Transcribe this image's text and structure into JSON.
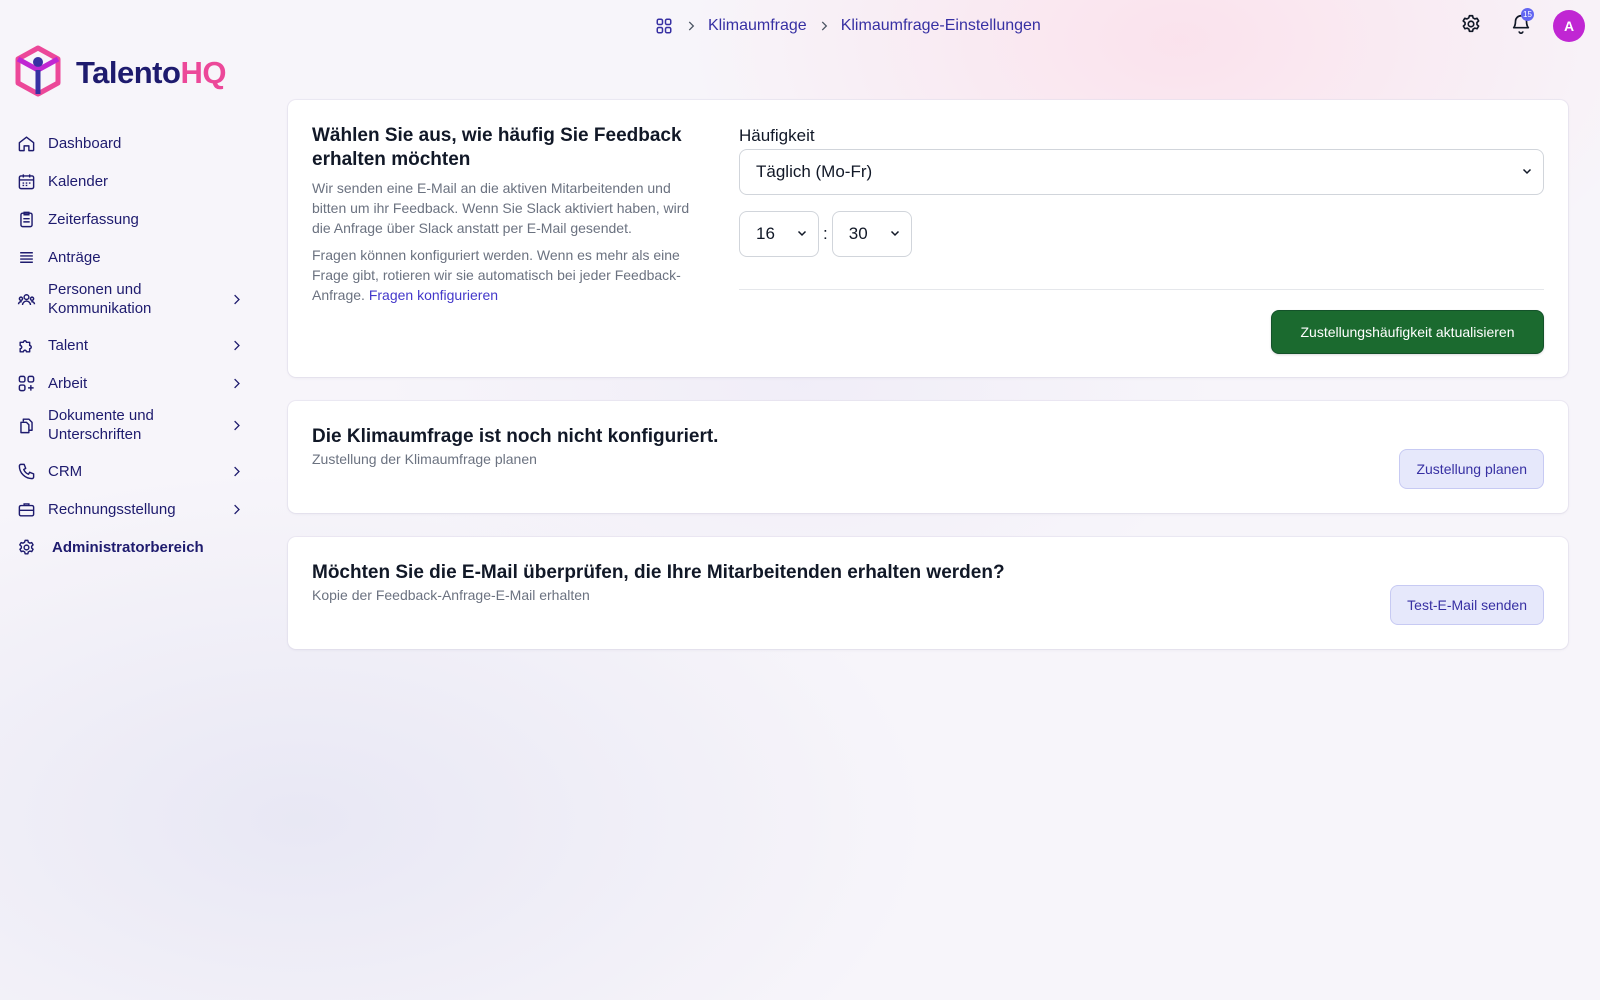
{
  "breadcrumb": {
    "items": [
      "Klimaumfrage",
      "Klimaumfrage-Einstellungen"
    ]
  },
  "topbar": {
    "notification_count": "15",
    "avatar_initial": "A"
  },
  "brand": {
    "name_part1": "Talento",
    "name_part2": "HQ",
    "colors": {
      "primary": "#1e1b6e",
      "accent": "#ec4899"
    }
  },
  "sidebar": {
    "items": [
      {
        "label": "Dashboard",
        "icon": "home-icon",
        "expandable": false
      },
      {
        "label": "Kalender",
        "icon": "calendar-icon",
        "expandable": false
      },
      {
        "label": "Zeiterfassung",
        "icon": "clipboard-icon",
        "expandable": false
      },
      {
        "label": "Anträge",
        "icon": "list-icon",
        "expandable": false
      },
      {
        "label": "Personen und Kommunikation",
        "icon": "users-icon",
        "expandable": true
      },
      {
        "label": "Talent",
        "icon": "puzzle-icon",
        "expandable": true
      },
      {
        "label": "Arbeit",
        "icon": "apps-add-icon",
        "expandable": true
      },
      {
        "label": "Dokumente und Unterschriften",
        "icon": "documents-icon",
        "expandable": true
      },
      {
        "label": "CRM",
        "icon": "phone-icon",
        "expandable": true
      },
      {
        "label": "Rechnungsstellung",
        "icon": "briefcase-icon",
        "expandable": true
      },
      {
        "label": "Administratorbereich",
        "icon": "gear-icon",
        "expandable": false
      }
    ]
  },
  "frequency_card": {
    "title": "Wählen Sie aus, wie häufig Sie Feedback erhalten möchten",
    "description1": "Wir senden eine E-Mail an die aktiven Mitarbeitenden und bitten um ihr Feedback. Wenn Sie Slack aktiviert haben, wird die Anfrage über Slack anstatt per E-Mail gesendet.",
    "description2": "Fragen können konfiguriert werden. Wenn es mehr als eine Frage gibt, rotieren wir sie automatisch bei jeder Feedback-Anfrage.",
    "link_label": "Fragen konfigurieren",
    "frequency_label": "Häufigkeit",
    "frequency_value": "Täglich (Mo-Fr)",
    "hour_value": "16",
    "time_separator": ":",
    "minute_value": "30",
    "submit_label": "Zustellungshäufigkeit aktualisieren"
  },
  "schedule_card": {
    "title": "Die Klimaumfrage ist noch nicht konfiguriert.",
    "subtitle": "Zustellung der Klimaumfrage planen",
    "button_label": "Zustellung planen"
  },
  "test_email_card": {
    "title": "Möchten Sie die E-Mail überprüfen, die Ihre Mitarbeitenden erhalten werden?",
    "subtitle": "Kopie der Feedback-Anfrage-E-Mail erhalten",
    "button_label": "Test-E-Mail senden"
  }
}
